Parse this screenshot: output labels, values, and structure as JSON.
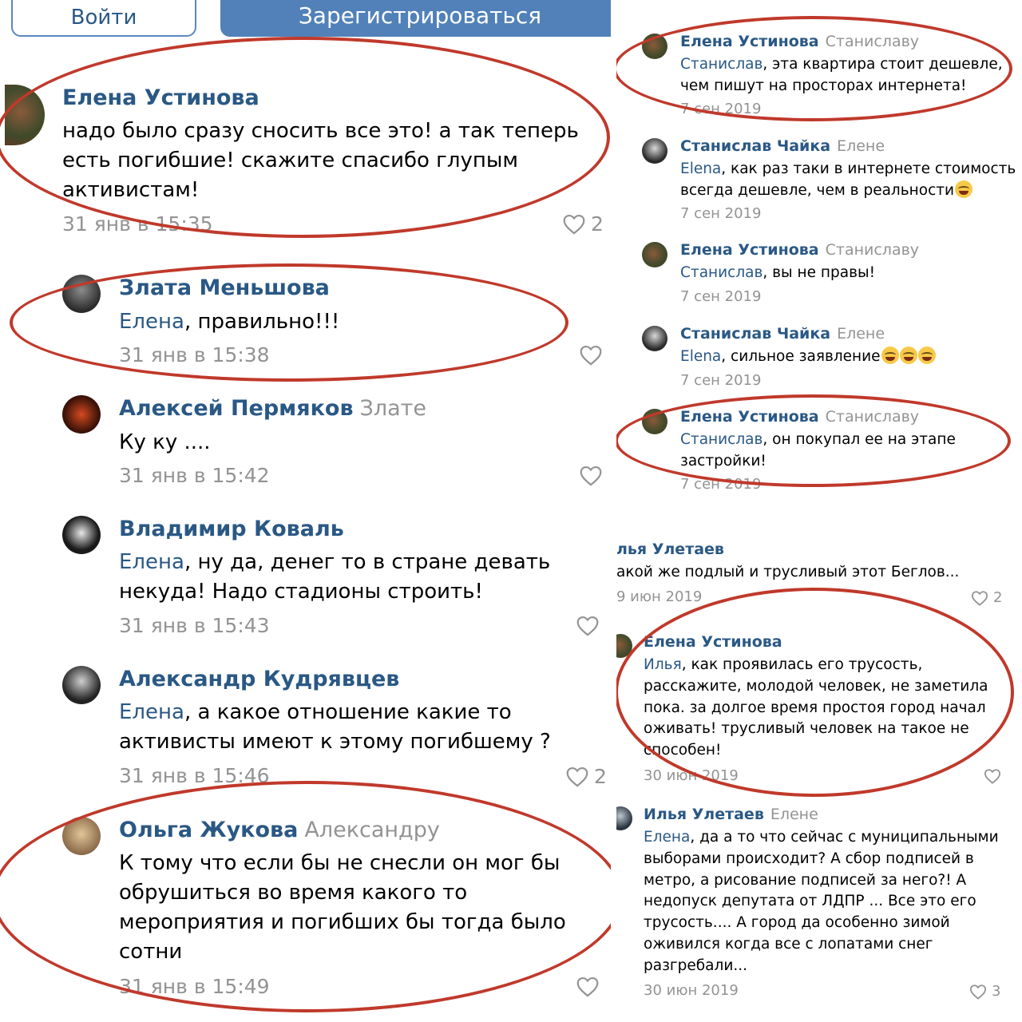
{
  "header": {
    "login_label": "Войти",
    "register_label": "Зарегистрироваться"
  },
  "left_comments": [
    {
      "author": "Елена Устинова",
      "reply_to": "",
      "addressee": "",
      "text": "надо было сразу сносить все это! а так теперь есть погибшие! скажите спасибо глупым активистам!",
      "date": "31 янв в 15:35",
      "likes": "2"
    },
    {
      "author": "Злата Меньшова",
      "reply_to": "",
      "addressee": "Елена",
      "text": ", правильно!!!",
      "date": "31 янв в 15:38",
      "likes": ""
    },
    {
      "author": "Алексей Пермяков",
      "reply_to": "Злате",
      "addressee": "",
      "text": "Ку ку ....",
      "date": "31 янв в 15:42",
      "likes": ""
    },
    {
      "author": "Владимир Коваль",
      "reply_to": "",
      "addressee": "Елена",
      "text": ", ну да, денег то в стране девать некуда! Надо стадионы строить!",
      "date": "31 янв в 15:43",
      "likes": ""
    },
    {
      "author": "Александр Кудрявцев",
      "reply_to": "",
      "addressee": "Елена",
      "text": ", а какое отношение какие то активисты имеют к этому погибшему ?",
      "date": "31 янв в 15:46",
      "likes": "2"
    },
    {
      "author": "Ольга Жукова",
      "reply_to": "Александру",
      "addressee": "",
      "text": "К тому что если бы не снесли он мог бы обрушиться во время какого то мероприятия и погибших бы тогда было сотни",
      "date": "31 янв в 15:49",
      "likes": ""
    }
  ],
  "right_top_comments": [
    {
      "author": "Елена Устинова",
      "reply_to": "Станиславу",
      "addressee": "Станислав",
      "text": ", эта квартира стоит дешевле, чем пишут на просторах интернета!",
      "date": "7 сен 2019"
    },
    {
      "author": "Станислав Чайка",
      "reply_to": "Елене",
      "addressee": "Elena",
      "text": ", как раз таки в интернете стоимость всегда дешевле, чем в реальности",
      "date": "7 сен 2019",
      "emoji_count": 1
    },
    {
      "author": "Елена Устинова",
      "reply_to": "Станиславу",
      "addressee": "Станислав",
      "text": ", вы не правы!",
      "date": "7 сен 2019"
    },
    {
      "author": "Станислав Чайка",
      "reply_to": "Елене",
      "addressee": "Elena",
      "text": ", сильное заявление",
      "date": "7 сен 2019",
      "emoji_count": 3
    },
    {
      "author": "Елена Устинова",
      "reply_to": "Станиславу",
      "addressee": "Станислав",
      "text": ", он покупал ее на этапе застройки!",
      "date": "7 сен 2019"
    }
  ],
  "right_bottom_comments": [
    {
      "author": "льяУлетаев",
      "author_display": "лья Улетаев",
      "reply_to": "",
      "addressee": "",
      "text": "акой же подлый и трусливый этот Беглов...",
      "date": "9 июн 2019",
      "likes": "2"
    },
    {
      "author": "Елена Устинова",
      "reply_to": "",
      "addressee": "Илья",
      "text": ", как проявилась его трусость, расскажите, молодой человек, не заметила пока. за долгое время простоя город начал оживать! трусливый человек на такое не способен!",
      "date": "30 июн 2019",
      "likes": ""
    },
    {
      "author": "Илья Улетаев",
      "reply_to": "Елене",
      "addressee": "Елена",
      "text": ", да а то что сейчас с муниципальными выборами происходит? А сбор подписей в метро, а рисование подписей за него?! А недопуск депутата от ЛДПР ... Все это его трусость.... А город да особенно зимой оживился когда все с лопатами снег разгребали...",
      "date": "30 июн 2019",
      "likes": "3"
    }
  ],
  "colors": {
    "link": "#2a5885",
    "muted": "#939393",
    "button": "#5181b8",
    "highlight": "#c0392b"
  },
  "icons": {
    "like": "heart-outline-icon",
    "emoji": "tears-of-joy-emoji"
  }
}
